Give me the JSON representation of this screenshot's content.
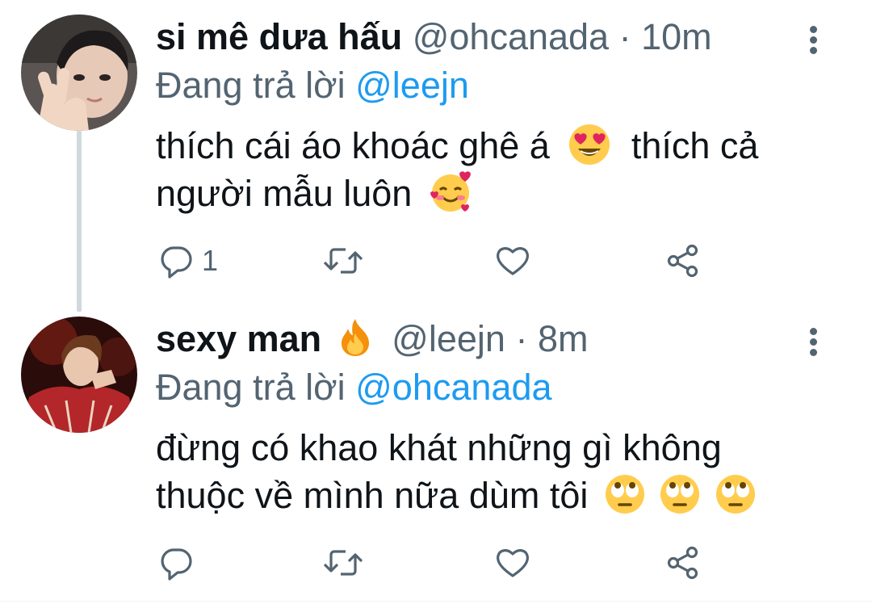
{
  "tweets": [
    {
      "display_name": "si mê dưa hấu",
      "name_emoji": "",
      "handle": "@ohcanada",
      "separator": "·",
      "time": "10m",
      "reply_prefix": "Đang trả lời",
      "reply_to": "@leejn",
      "text_line1": "thích cái áo khoác ghê á",
      "text_line1_tail": "thích cả",
      "text_line2": "người mẫu luôn",
      "emojis": [
        "smiling-face-with-heart-eyes",
        "smiling-face-with-hearts"
      ],
      "reply_count": "1",
      "retweet_count": "",
      "like_count": ""
    },
    {
      "display_name": "sexy man",
      "name_emoji": "fire",
      "handle": "@leejn",
      "separator": "·",
      "time": "8m",
      "reply_prefix": "Đang trả lời",
      "reply_to": "@ohcanada",
      "text_line1": "đừng có khao khát những gì không",
      "text_line2": "thuộc về mình nữa dùm tôi",
      "emojis": [
        "face-with-rolling-eyes",
        "face-with-rolling-eyes",
        "face-with-rolling-eyes"
      ],
      "reply_count": "",
      "retweet_count": "",
      "like_count": ""
    }
  ],
  "icons": {
    "reply": "reply-icon",
    "retweet": "retweet-icon",
    "like": "heart-icon",
    "share": "share-icon",
    "more": "more-options-icon"
  },
  "colors": {
    "text": "#0f1419",
    "secondary": "#536471",
    "link": "#1d9bf0",
    "thread_line": "#cfd9de"
  }
}
